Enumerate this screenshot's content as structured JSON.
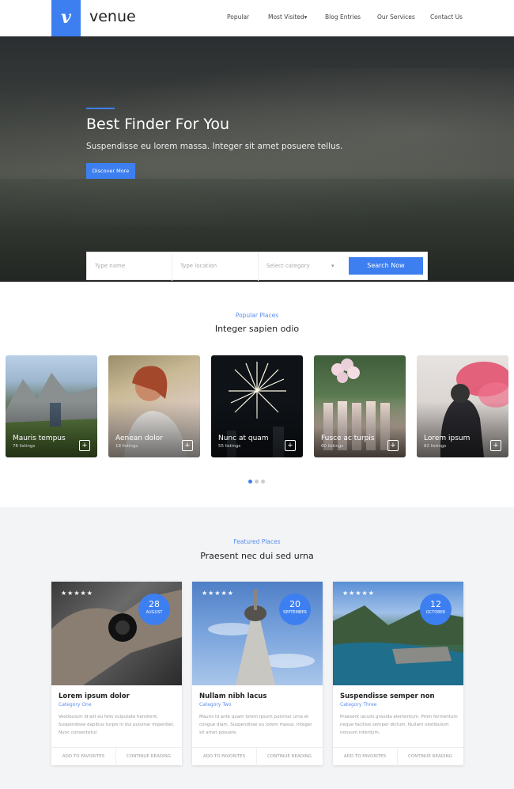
{
  "brand": {
    "logo_letter": "v",
    "name": "venue",
    "accent": "#3d7ff0"
  },
  "nav": {
    "items": [
      "Popular",
      "Most Visited",
      "Blog Entries",
      "Our Services",
      "Contact Us"
    ],
    "dropdown_caret": "▾"
  },
  "hero": {
    "title": "Best Finder For You",
    "subtitle": "Suspendisse eu lorem massa. Integer sit amet posuere tellus.",
    "button": "Discover More"
  },
  "search": {
    "name_placeholder": "Type name",
    "location_placeholder": "Type location",
    "category_placeholder": "Select category",
    "button": "Search Now"
  },
  "popular": {
    "kicker": "Popular Places",
    "title": "Integer sapien odio",
    "cards": [
      {
        "name": "Mauris tempus",
        "count": "76 listings"
      },
      {
        "name": "Aenean dolor",
        "count": "18 listings"
      },
      {
        "name": "Nunc at quam",
        "count": "55 listings"
      },
      {
        "name": "Fusce ac turpis",
        "count": "60 listings"
      },
      {
        "name": "Lorem ipsum",
        "count": "82 listings"
      }
    ]
  },
  "featured": {
    "kicker": "Featured Places",
    "title": "Praesent nec dui sed urna",
    "stars": "★★★★★",
    "cards": [
      {
        "day": "28",
        "month": "AUGUST",
        "title": "Lorem ipsum dolor",
        "category": "Category One",
        "desc": "Vestibulum id est eu felis vulputate hendrerit. Suspendisse dapibus turpis in dui pulvinar imperdiet. Nunc consectetur."
      },
      {
        "day": "20",
        "month": "SEPTEMBER",
        "title": "Nullam nibh lacus",
        "category": "Category Two",
        "desc": "Mauris id ante quam lorem ipsum pulvinar urna et congue diam. Suspendisse eu lorem massa. Integer sit amet posuere."
      },
      {
        "day": "12",
        "month": "OCTOBER",
        "title": "Suspendisse semper non",
        "category": "Category Three",
        "desc": "Praesent iaculis gravida elementum. Proin fermentum neque facilisis semper dictum. Nullam vestibulum nonsum interdum."
      }
    ],
    "action_favorites": "ADD TO FAVORITES",
    "action_continue": "CONTINUE READING"
  }
}
